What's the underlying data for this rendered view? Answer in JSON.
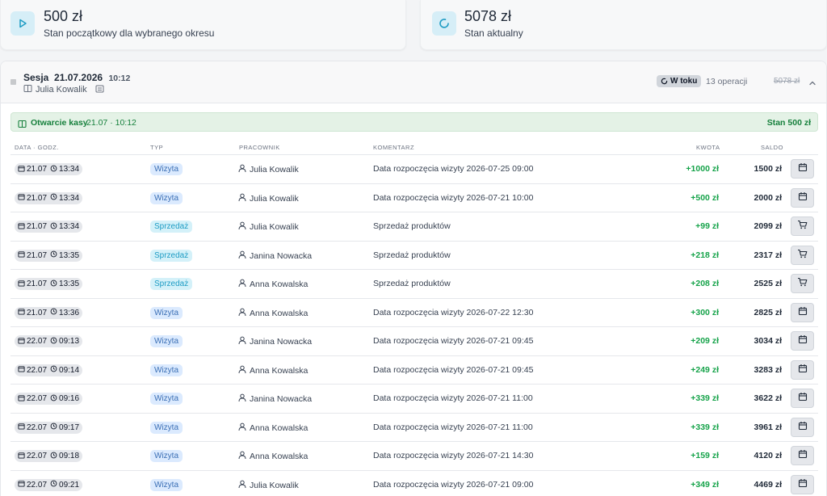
{
  "cards": [
    {
      "amount": "500 zł",
      "description": "Stan początkowy dla wybranego okresu",
      "icon": "play-icon"
    },
    {
      "amount": "5078 zł",
      "description": "Stan aktualny",
      "icon": "refresh-icon"
    }
  ],
  "session": {
    "label": "Sesja",
    "date": "21.07.2026",
    "time": "10:12",
    "cashier": "Julia Kowalik",
    "status": "W toku",
    "operations": "13 operacji",
    "struck_amount": "5078 zł"
  },
  "opening": {
    "label": "Otwarcie kasy",
    "when": "21.07 · 10:12",
    "balance": "Stan 500 zł"
  },
  "columns": {
    "datetime": "DATA · GODZ.",
    "type": "TYP",
    "employee": "PRACOWNIK",
    "comment": "KOMENTARZ",
    "amount": "KWOTA",
    "balance": "SALDO"
  },
  "rows": [
    {
      "date": "21.07",
      "time": "13:34",
      "type": "Wizyta",
      "kind": "w",
      "employee": "Julia Kowalik",
      "comment": "Data rozpoczęcia wizyty 2026-07-25 09:00",
      "amount": "+1000 zł",
      "balance": "1500 zł",
      "action_icon": "calendar-icon"
    },
    {
      "date": "21.07",
      "time": "13:34",
      "type": "Wizyta",
      "kind": "w",
      "employee": "Julia Kowalik",
      "comment": "Data rozpoczęcia wizyty 2026-07-21 10:00",
      "amount": "+500 zł",
      "balance": "2000 zł",
      "action_icon": "calendar-icon"
    },
    {
      "date": "21.07",
      "time": "13:34",
      "type": "Sprzedaż",
      "kind": "s",
      "employee": "Julia Kowalik",
      "comment": "Sprzedaż produktów",
      "amount": "+99 zł",
      "balance": "2099 zł",
      "action_icon": "cart-icon"
    },
    {
      "date": "21.07",
      "time": "13:35",
      "type": "Sprzedaż",
      "kind": "s",
      "employee": "Janina Nowacka",
      "comment": "Sprzedaż produktów",
      "amount": "+218 zł",
      "balance": "2317 zł",
      "action_icon": "cart-icon"
    },
    {
      "date": "21.07",
      "time": "13:35",
      "type": "Sprzedaż",
      "kind": "s",
      "employee": "Anna Kowalska",
      "comment": "Sprzedaż produktów",
      "amount": "+208 zł",
      "balance": "2525 zł",
      "action_icon": "cart-icon"
    },
    {
      "date": "21.07",
      "time": "13:36",
      "type": "Wizyta",
      "kind": "w",
      "employee": "Anna Kowalska",
      "comment": "Data rozpoczęcia wizyty 2026-07-22 12:30",
      "amount": "+300 zł",
      "balance": "2825 zł",
      "action_icon": "calendar-icon"
    },
    {
      "date": "22.07",
      "time": "09:13",
      "type": "Wizyta",
      "kind": "w",
      "employee": "Janina Nowacka",
      "comment": "Data rozpoczęcia wizyty 2026-07-21 09:45",
      "amount": "+209 zł",
      "balance": "3034 zł",
      "action_icon": "calendar-icon"
    },
    {
      "date": "22.07",
      "time": "09:14",
      "type": "Wizyta",
      "kind": "w",
      "employee": "Anna Kowalska",
      "comment": "Data rozpoczęcia wizyty 2026-07-21 09:45",
      "amount": "+249 zł",
      "balance": "3283 zł",
      "action_icon": "calendar-icon"
    },
    {
      "date": "22.07",
      "time": "09:16",
      "type": "Wizyta",
      "kind": "w",
      "employee": "Janina Nowacka",
      "comment": "Data rozpoczęcia wizyty 2026-07-21 11:00",
      "amount": "+339 zł",
      "balance": "3622 zł",
      "action_icon": "calendar-icon"
    },
    {
      "date": "22.07",
      "time": "09:17",
      "type": "Wizyta",
      "kind": "w",
      "employee": "Anna Kowalska",
      "comment": "Data rozpoczęcia wizyty 2026-07-21 11:00",
      "amount": "+339 zł",
      "balance": "3961 zł",
      "action_icon": "calendar-icon"
    },
    {
      "date": "22.07",
      "time": "09:18",
      "type": "Wizyta",
      "kind": "w",
      "employee": "Anna Kowalska",
      "comment": "Data rozpoczęcia wizyty 2026-07-21 14:30",
      "amount": "+159 zł",
      "balance": "4120 zł",
      "action_icon": "calendar-icon"
    },
    {
      "date": "22.07",
      "time": "09:21",
      "type": "Wizyta",
      "kind": "w",
      "employee": "Julia Kowalik",
      "comment": "Data rozpoczęcia wizyty 2026-07-21 09:00",
      "amount": "+349 zł",
      "balance": "4469 zł",
      "action_icon": "calendar-icon"
    }
  ],
  "colors": {
    "accent_cyan": "#1e9cc4",
    "success_green": "#16a34a",
    "visit_blue": "#3b6fb5"
  }
}
